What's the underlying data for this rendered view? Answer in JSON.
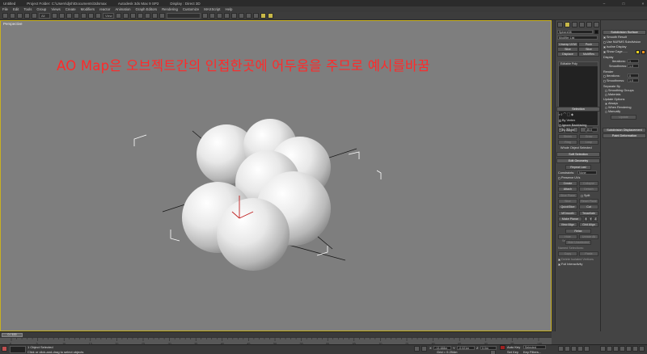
{
  "title": {
    "doc": "Untitled",
    "project": "Project Folder: C:\\Users\\djsh\\Documents\\3dsmax",
    "app": "Autodesk 3ds Max  9 SP2",
    "display": "Display : Direct 3D"
  },
  "menu": [
    "File",
    "Edit",
    "Tools",
    "Group",
    "Views",
    "Create",
    "Modifiers",
    "reactor",
    "Animation",
    "Graph Editors",
    "Rendering",
    "Customize",
    "MAXScript",
    "Help"
  ],
  "toolbar": {
    "filter": "All",
    "view_ref": "View",
    "named_sel": ""
  },
  "viewport": {
    "label": "Perspective",
    "annotation": "AO Map은 오브젝트간의 인접한곳에 어두움을 주므로 예시를바꿈",
    "border_color": "#c8b020",
    "bg_color": "#7e7e7e"
  },
  "command_panel": {
    "object_name": "Sphere08",
    "modifier_list": "Modifier List",
    "buttons": [
      "Unwrap UVW",
      "Push",
      "Slice",
      "Slice",
      "Displace",
      "MultiRes"
    ],
    "stack_item": "Editable Poly",
    "selection": {
      "title": "Selection",
      "by_vertex": "By Vertex",
      "ignore_backfacing": "Ignore Backfacing",
      "by_angle": "By Angle:",
      "angle": "45.0",
      "shrink": "Shrink",
      "grow": "Grow",
      "ring": "Ring",
      "loop": "Loop",
      "status": "Whole Object Selected"
    },
    "soft_selection": "Soft Selection",
    "edit_geometry": {
      "title": "Edit Geometry",
      "repeat_last": "Repeat Last",
      "constraints": "Constraints:",
      "constraints_value": "None",
      "preserve_uvs": "Preserve UVs",
      "create": "Create",
      "collapse": "Collapse",
      "attach": "Attach",
      "detach": "Detach",
      "slice_plane": "Slice Plane",
      "split": "Split",
      "slice": "Slice",
      "reset_plane": "Reset Plane",
      "quickslice": "QuickSlice",
      "cut": "Cut",
      "msmooth": "MSmooth",
      "tessellate": "Tessellate",
      "make_planar": "Make Planar",
      "x": "X",
      "y": "Y",
      "z": "Z",
      "view_align": "View Align",
      "grid_align": "Grid Align",
      "relax": "Relax",
      "hide_selected": "Hide Selected",
      "unhide_all": "Unhide All",
      "hide_unselected": "Hide Unselected",
      "named_selections": "Named Selections:",
      "copy": "Copy",
      "paste": "Paste",
      "delete_isolated": "Delete Isolated Vertices",
      "full_interactivity": "Full Interactivity"
    }
  },
  "right_panel": {
    "subdivision_surface": "Subdivision Surface",
    "smooth_result": "Smooth Result",
    "use_nurms": "Use NURMS Subdivision",
    "isoline_display": "Isoline Display",
    "show_cage": "Show Cage......",
    "display": "Display",
    "iterations_label": "Iterations:",
    "iterations": "1",
    "smoothness_label": "Smoothness:",
    "smoothness": "1.0",
    "render": "Render",
    "r_iterations": "0",
    "r_smoothness": "1.0",
    "separate_by": "Separate By",
    "smoothing_groups": "Smoothing Groups",
    "materials": "Materials",
    "update_options": "Update Options",
    "always": "Always",
    "when_rendering": "When Rendering",
    "manually": "Manually",
    "update": "Update",
    "subdivision_displacement": "Subdivision Displacement",
    "paint_deformation": "Paint Deformation",
    "cage_color1": "#e8d020",
    "cage_color2": "#e89020"
  },
  "timeline": {
    "slider": "0 / 100",
    "ticks": [
      "0",
      "5",
      "10",
      "15",
      "20",
      "25",
      "30",
      "35",
      "40",
      "45",
      "50",
      "55",
      "60",
      "65",
      "70",
      "75",
      "80",
      "85",
      "90",
      "95",
      "100"
    ]
  },
  "status": {
    "selected": "1 Object Selected",
    "prompt": "Click or click-and-drag to select objects",
    "x": "-13.488m",
    "y": "-0.021m",
    "z": "0.0m",
    "grid": "Grid = 0.254m",
    "auto_key": "Auto Key",
    "selected_dd": "Selected",
    "set_key": "Set Key",
    "key_filters": "Key Filters..."
  }
}
